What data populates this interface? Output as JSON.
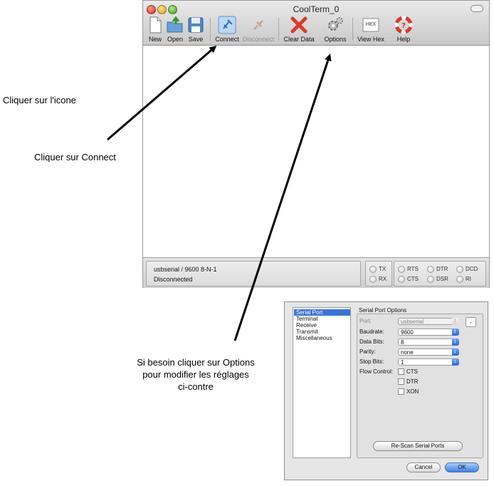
{
  "window": {
    "title": "CoolTerm_0",
    "toolbar": {
      "new": "New",
      "open": "Open",
      "save": "Save",
      "connect": "Connect",
      "disconnect": "Disconnect",
      "clear_data": "Clear Data",
      "options": "Options",
      "view_hex": "View Hex",
      "hex_icon_text": "HEX",
      "help": "Help"
    },
    "status": {
      "port_line": "usbserial / 9600 8-N-1",
      "state": "Disconnected",
      "leds": {
        "tx": "TX",
        "rx": "RX",
        "rts": "RTS",
        "cts": "CTS",
        "dtr": "DTR",
        "dsr": "DSR",
        "dcd": "DCD",
        "ri": "RI"
      }
    }
  },
  "annotations": {
    "icon": "Cliquer sur l'icone",
    "connect": "Cliquer sur Connect",
    "options_line1": "Si besoin cliquer sur Options",
    "options_line2": "pour modifier les réglages",
    "options_line3": "ci-contre"
  },
  "dialog": {
    "categories": [
      "Serial Port",
      "Terminal",
      "Receive",
      "Transmit",
      "Miscellaneous"
    ],
    "heading": "Serial Port Options",
    "port": {
      "label": "Port:",
      "value": "usbserial"
    },
    "baudrate": {
      "label": "Baudrate:",
      "value": "9600"
    },
    "data_bits": {
      "label": "Data Bits:",
      "value": "8"
    },
    "parity": {
      "label": "Parity:",
      "value": "none"
    },
    "stop_bits": {
      "label": "Stop Bits:",
      "value": "1"
    },
    "flow_control": {
      "label": "Flow Control:",
      "cts": "CTS",
      "dtr": "DTR",
      "xon": "XON"
    },
    "rescan": "Re-Scan Serial Ports",
    "cancel": "Cancel",
    "ok": "OK"
  },
  "colors": {
    "selection": "#3875d7",
    "default_button": "#3c82e6",
    "arrow": "#000000"
  }
}
